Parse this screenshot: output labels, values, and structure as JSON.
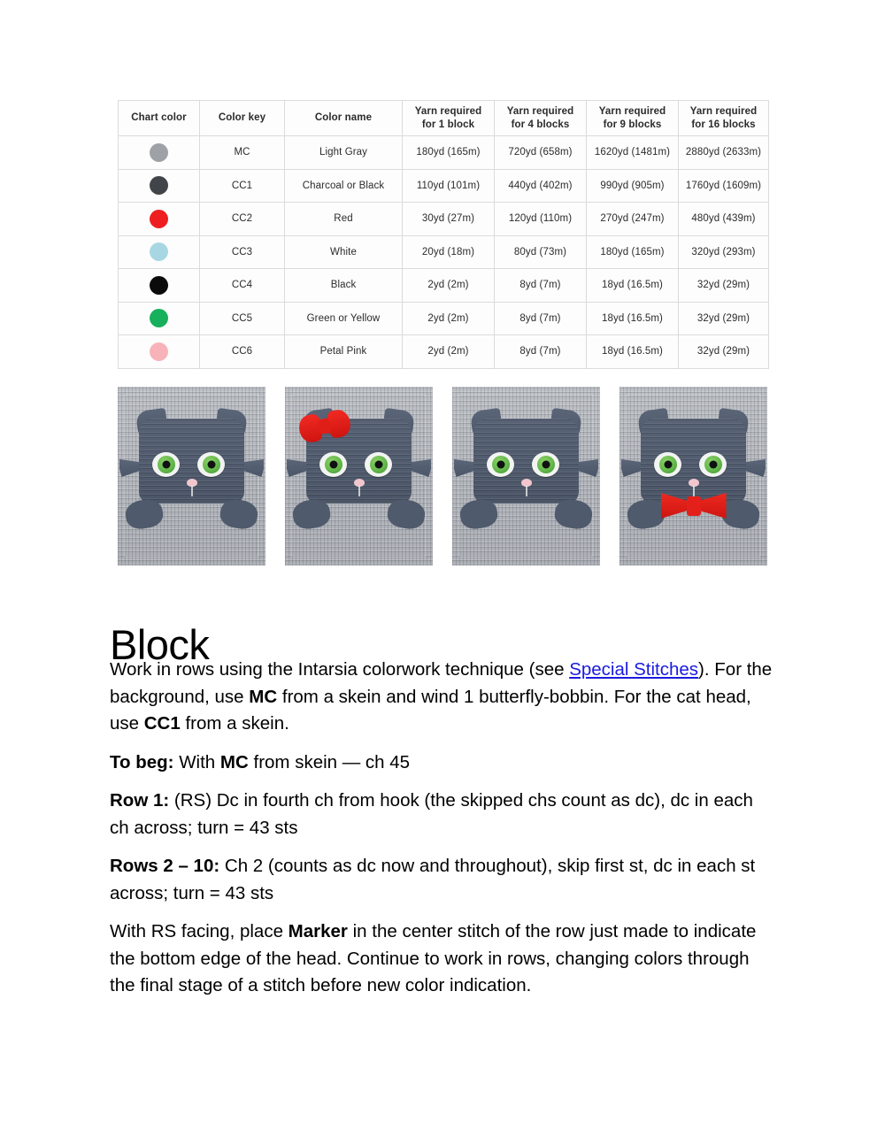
{
  "table": {
    "headers": [
      {
        "line1": "Chart color",
        "line2": ""
      },
      {
        "line1": "Color key",
        "line2": ""
      },
      {
        "line1": "Color name",
        "line2": ""
      },
      {
        "line1": "Yarn required",
        "line2": "for 1 block"
      },
      {
        "line1": "Yarn required",
        "line2": "for 4 blocks"
      },
      {
        "line1": "Yarn required",
        "line2": "for 9 blocks"
      },
      {
        "line1": "Yarn required",
        "line2": "for 16 blocks"
      }
    ],
    "rows": [
      {
        "swatch": "#9ea1a5",
        "key": "MC",
        "name": "Light Gray",
        "y1": "180yd (165m)",
        "y4": "720yd (658m)",
        "y9": "1620yd (1481m)",
        "y16": "2880yd (2633m)"
      },
      {
        "swatch": "#414549",
        "key": "CC1",
        "name": "Charcoal or Black",
        "y1": "110yd (101m)",
        "y4": "440yd (402m)",
        "y9": "990yd (905m)",
        "y16": "1760yd (1609m)"
      },
      {
        "swatch": "#ee1d20",
        "key": "CC2",
        "name": "Red",
        "y1": "30yd (27m)",
        "y4": "120yd (110m)",
        "y9": "270yd (247m)",
        "y16": "480yd (439m)"
      },
      {
        "swatch": "#a8d7e4",
        "key": "CC3",
        "name": "White",
        "y1": "20yd (18m)",
        "y4": "80yd (73m)",
        "y9": "180yd (165m)",
        "y16": "320yd (293m)"
      },
      {
        "swatch": "#0b0b0b",
        "key": "CC4",
        "name": "Black",
        "y1": "2yd (2m)",
        "y4": "8yd (7m)",
        "y9": "18yd (16.5m)",
        "y16": "32yd (29m)"
      },
      {
        "swatch": "#17b05c",
        "key": "CC5",
        "name": "Green or Yellow",
        "y1": "2yd (2m)",
        "y4": "8yd (7m)",
        "y9": "18yd (16.5m)",
        "y16": "32yd (29m)"
      },
      {
        "swatch": "#f7b3b9",
        "key": "CC6",
        "name": "Petal Pink",
        "y1": "2yd (2m)",
        "y4": "8yd (7m)",
        "y9": "18yd (16.5m)",
        "y16": "32yd (29m)"
      }
    ]
  },
  "photos": [
    {
      "caption": "crochet cat block plain"
    },
    {
      "caption": "crochet cat block with red hair bow"
    },
    {
      "caption": "crochet cat block plain alternate"
    },
    {
      "caption": "crochet cat block with red bow tie"
    }
  ],
  "content": {
    "heading": "Block",
    "p1_a": "Work in rows using the Intarsia colorwork technique (see ",
    "p1_link": "Special Stitches",
    "p1_b": "). For the background, use ",
    "p1_mc": "MC",
    "p1_c": " from a skein and wind 1 butterfly-bobbin. For the cat head, use ",
    "p1_cc1": "CC1",
    "p1_d": " from a skein.",
    "p2_label": "To beg:",
    "p2_a": " With ",
    "p2_mc": "MC",
    "p2_b": " from skein — ch 45",
    "p3_label": "Row 1:",
    "p3_text": " (RS) Dc in fourth ch from hook (the skipped chs count as dc), dc in each ch across; turn = 43 sts",
    "p4_label": "Rows 2 – 10:",
    "p4_text": " Ch 2 (counts as dc now and throughout), skip first st, dc in each st across; turn = 43 sts",
    "p5_a": "With RS facing, place ",
    "p5_marker": "Marker",
    "p5_b": " in the center stitch of the row just made to indicate the bottom edge of the head. Continue to work in rows, changing colors through the final stage of a stitch before new color indication."
  }
}
